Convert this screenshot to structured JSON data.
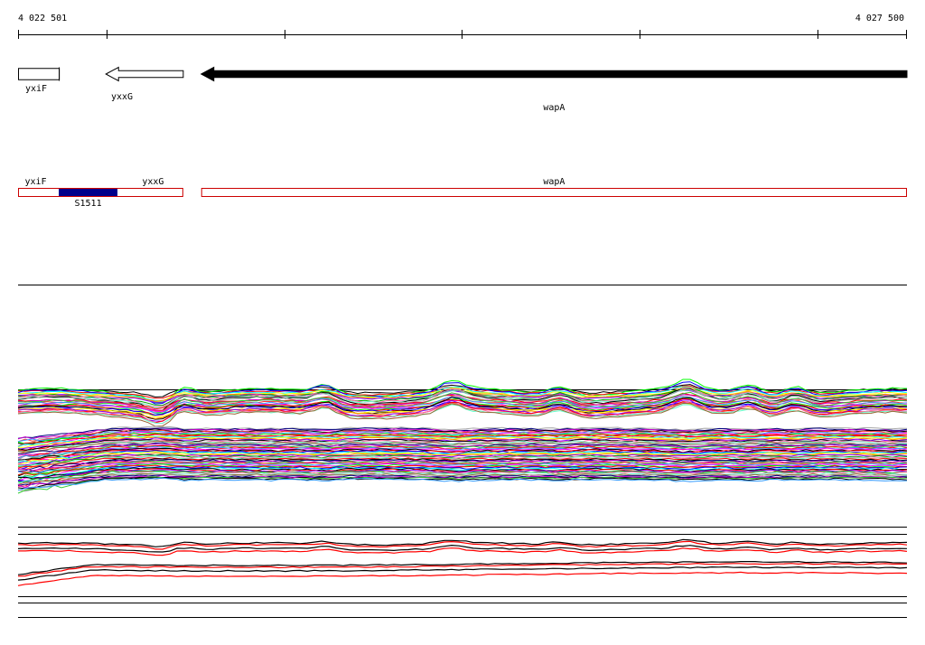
{
  "coordinates": {
    "start_label": "4 022 501",
    "end_label": "4 027 500",
    "start": 4022501,
    "end": 4027500
  },
  "genes": [
    {
      "name": "yxiF",
      "strand": "none",
      "fill": "#ffffff",
      "start": 4022501,
      "end": 4022730
    },
    {
      "name": "yxxG",
      "strand": "-",
      "fill": "#ffffff",
      "start": 4022995,
      "end": 4023430
    },
    {
      "name": "wapA",
      "strand": "-",
      "fill": "#000000",
      "start": 4023531,
      "end": 4027500
    }
  ],
  "annotation_track": {
    "boxes": [
      {
        "label": "yxiF",
        "start": 4022501,
        "end": 4023430
      },
      {
        "label": "wapA",
        "start": 4023531,
        "end": 4027500
      }
    ],
    "inner_labels": [
      {
        "text": "yxiF",
        "pos": 4022600
      },
      {
        "text": "yxxG",
        "pos": 4023260
      }
    ],
    "feature": {
      "label": "S1511",
      "start": 4022730,
      "end": 4023060,
      "color": "#00008b"
    },
    "outline_color": "#cc0000"
  },
  "chart_data": {
    "type": "line",
    "title": "",
    "xlabel": "",
    "ylabel": "",
    "xlim": [
      4022501,
      4027500
    ],
    "grid": false,
    "panels": [
      {
        "name": "panel-multicolor",
        "band_top_baseline": 0.08,
        "band_bottom_baseline": 0.42,
        "series_count": 90
      },
      {
        "name": "panel-black-red",
        "colors": [
          "#000000",
          "#ff0000"
        ],
        "series_count": 8
      }
    ]
  }
}
